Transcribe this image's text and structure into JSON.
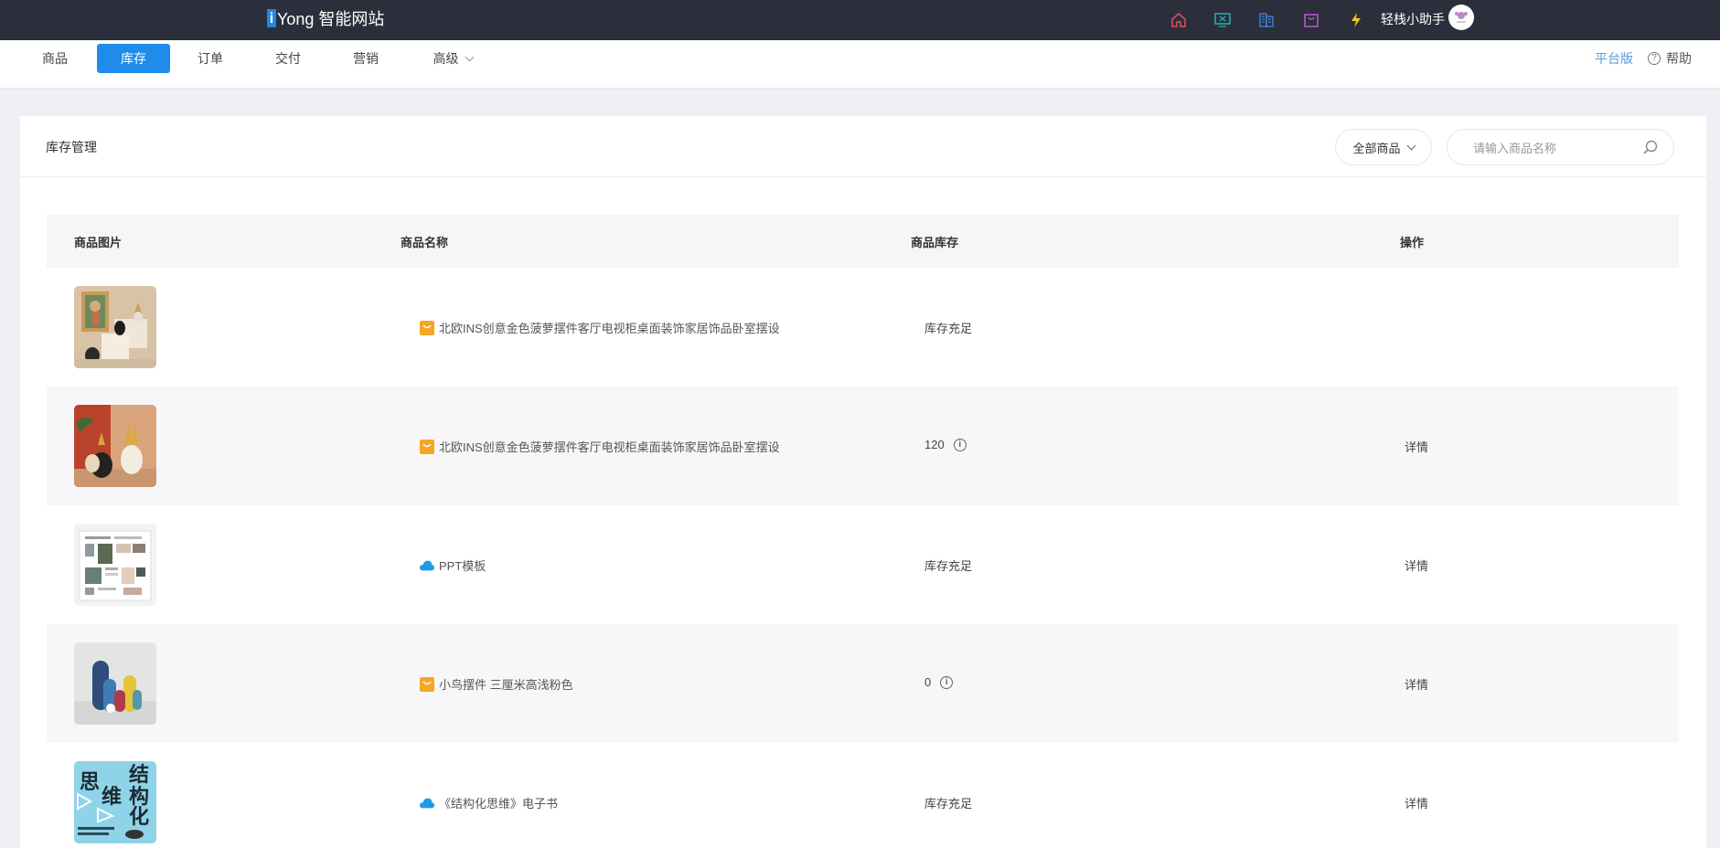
{
  "brand": {
    "mark": "i",
    "name": "Yong 智能网站"
  },
  "topbar": {
    "icons": [
      "home-icon",
      "monitor-icon",
      "building-icon",
      "bag-icon",
      "lightning-icon"
    ],
    "assistant": "轻栈小助手"
  },
  "tabs": [
    {
      "label": "商品"
    },
    {
      "label": "库存"
    },
    {
      "label": "订单"
    },
    {
      "label": "交付"
    },
    {
      "label": "营销"
    },
    {
      "label": "高级"
    }
  ],
  "active_tab": "库存",
  "platform_label": "平台版",
  "help_label": "帮助",
  "card": {
    "title": "库存管理",
    "filter_label": "全部商品",
    "search_placeholder": "请输入商品名称"
  },
  "table": {
    "headers": {
      "image": "商品图片",
      "name": "商品名称",
      "stock": "商品库存",
      "op": "操作"
    },
    "rows": [
      {
        "thumb": "vase-photo",
        "type_icon": "bag-icon",
        "name": "北欧INS创意金色菠萝摆件客厅电视柜桌面装饰家居饰品卧室摆设",
        "stock": "库存充足",
        "info": false,
        "op": ""
      },
      {
        "thumb": "pineapple-photo",
        "type_icon": "bag-icon",
        "name": "北欧INS创意金色菠萝摆件客厅电视柜桌面装饰家居饰品卧室摆设",
        "stock": "120",
        "info": true,
        "op": "详情"
      },
      {
        "thumb": "ppt-photo",
        "type_icon": "cloud-icon",
        "name": "PPT模板",
        "stock": "库存充足",
        "info": false,
        "op": "详情"
      },
      {
        "thumb": "bird-photo",
        "type_icon": "bag-icon",
        "name": "小鸟摆件 三厘米高浅粉色",
        "stock": "0",
        "info": true,
        "op": "详情"
      },
      {
        "thumb": "book-photo",
        "type_icon": "cloud-icon",
        "name": "《结构化思维》电子书",
        "stock": "库存充足",
        "info": false,
        "op": "详情"
      }
    ]
  },
  "book_cover_text": [
    "结",
    "思",
    "构",
    "维",
    "化"
  ],
  "colors": {
    "topbar": "#2b2f3b",
    "accent": "#1e8ce8",
    "bag_icon": "#f5a623",
    "cloud_icon": "#1e9be8"
  }
}
